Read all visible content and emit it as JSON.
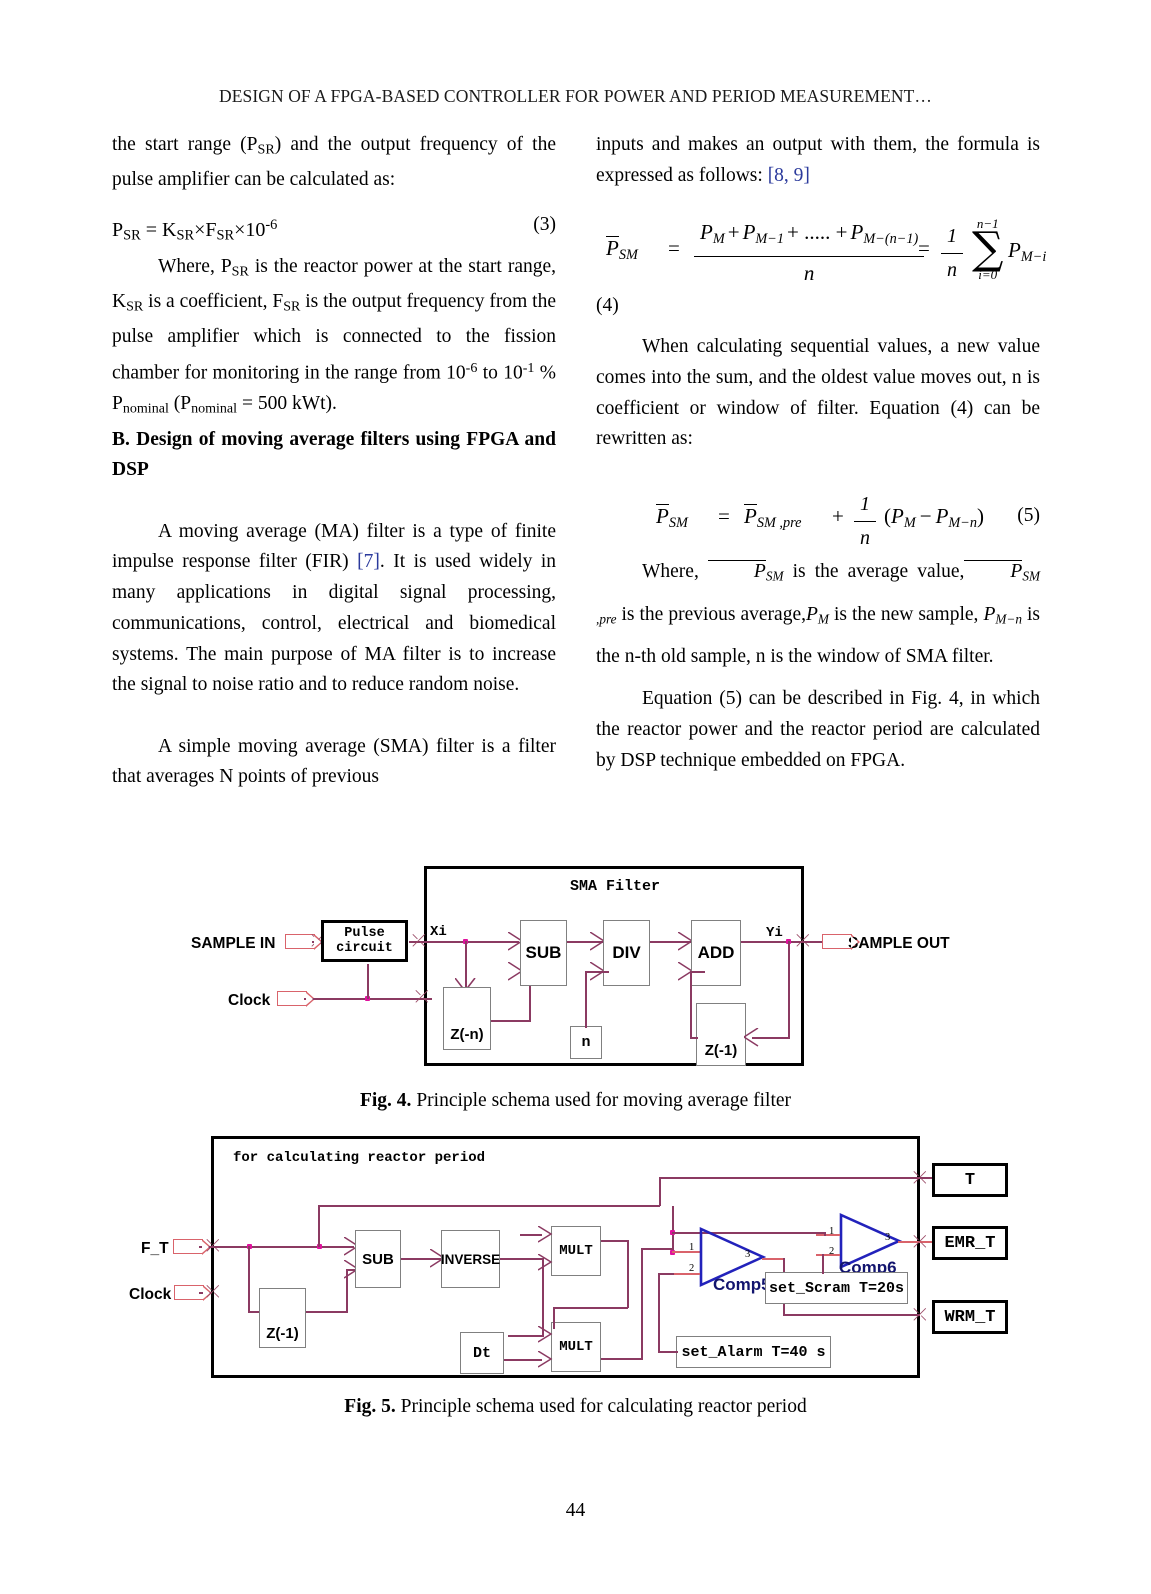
{
  "running_head": "DESIGN OF A FPGA-BASED CONTROLLER FOR POWER AND PERIOD MEASUREMENT…",
  "page_number": "44",
  "left_column": {
    "para1_part1": "the start range (P",
    "para1_sub1": "SR",
    "para1_part2": ") and the output frequency of the pulse amplifier can be calculated as:",
    "eq3": {
      "lhs": "P",
      "lhs_sub": "SR",
      "eq": " = K",
      "k_sub": "SR",
      "times1": "×F",
      "f_sub": "SR",
      "times2": "×10",
      "exp": "-6",
      "number": "(3)"
    },
    "para2": {
      "t1": "Where, P",
      "s1": "SR",
      "t2": " is the reactor power at the start range, K",
      "s2": "SR",
      "t3": " is a coefficient, F",
      "s3": "SR",
      "t4": " is the output frequency from the pulse amplifier which is connected to the fission chamber for monitoring in the range from 10",
      "e1": "-6",
      "t5": " to 10",
      "e2": "-1",
      "t6": " % P",
      "s4": "nominal",
      "t7": " (P",
      "s5": "nominal",
      "t8": " = 500 kWt)."
    },
    "heading_b": "B. Design of moving average filters using FPGA and DSP",
    "para3": {
      "t1": "A moving average (MA) filter is a type of finite impulse response filter (FIR) ",
      "ref": "[7]",
      "t2": ". It is used widely in many applications in digital signal processing, communications, control, electrical and biomedical systems. The main purpose of MA filter is to increase the signal to noise ratio and to reduce random noise."
    },
    "para4": "A simple moving average (SMA) filter is a filter that averages N points of previous"
  },
  "right_column": {
    "para1": {
      "t1": "inputs and makes an output with them, the formula is expressed as follows: ",
      "ref": "[8, 9]"
    },
    "eq4": {
      "lhs_p": "P",
      "lhs_sub": "SM",
      "eq1": "=",
      "num_a": "P",
      "num_a_sub": "M",
      "num_plus1": "+",
      "num_b": "P",
      "num_b_sub": "M−1",
      "num_dots": "+ ..... +",
      "num_c": "P",
      "num_c_sub": "M−(n−1)",
      "den": "n",
      "eq2": "=",
      "frac_num": "1",
      "frac_den": "n",
      "sum_top": "n−1",
      "sum_bottom": "i=0",
      "sum_body": "P",
      "sum_body_sub": "M−i",
      "number": "(4)"
    },
    "para2": "When calculating sequential values, a new value comes into the sum, and the oldest value moves out, n is coefficient or window of filter. Equation (4) can be rewritten as:",
    "eq5": {
      "lhs_p": "P",
      "lhs_sub": "SM",
      "eq1": "=",
      "rhs_p": "P",
      "rhs_sub": "SM ,pre",
      "plus": "+",
      "frac_num": "1",
      "frac_den": "n",
      "paren_open": "(",
      "pm": "P",
      "pm_sub": "M",
      "minus": "−",
      "pmn": "P",
      "pmn_sub": "M−n",
      "paren_close": ")",
      "number": "(5)"
    },
    "para3": {
      "t1": "Where, ",
      "m1": "P",
      "m1_sub": "SM",
      "t2": " is the average value,",
      "m2": "P",
      "m2_sub": "SM ,pre",
      "t3": " is the previous average,",
      "m3": "P",
      "m3_sub": "M",
      "t4": " is the new sample,",
      "m4": "P",
      "m4_sub": "M−n",
      "t5": " is the n-th old sample, n is the window of SMA filter."
    },
    "para4": "Equation (5) can be described in Fig. 4, in which the reactor power and the reactor period are calculated by DSP technique embedded on FPGA."
  },
  "figure4": {
    "caption_label": "Fig. 4.",
    "caption_text": " Principle schema used for moving average filter",
    "title": "SMA Filter",
    "ports_in": [
      "SAMPLE IN",
      "Clock"
    ],
    "ports_out": [
      "SAMPLE OUT"
    ],
    "signal_labels": [
      "Xi",
      "Yi"
    ],
    "blocks": [
      {
        "name": "pulse-circuit",
        "label_line1": "Pulse",
        "label_line2": "circuit"
      },
      {
        "name": "delay-n",
        "label": "Z(-n)"
      },
      {
        "name": "sub",
        "label": "SUB"
      },
      {
        "name": "div",
        "label": "DIV"
      },
      {
        "name": "n-const",
        "label": "n"
      },
      {
        "name": "add",
        "label": "ADD"
      },
      {
        "name": "delay-1",
        "label": "Z(-1)"
      }
    ]
  },
  "figure5": {
    "caption_label": "Fig. 5.",
    "caption_text": " Principle schema used for calculating reactor period",
    "title": "for calculating reactor period",
    "ports_in": [
      "F_T",
      "Clock"
    ],
    "blocks": [
      {
        "name": "delay-1",
        "label": "Z(-1)"
      },
      {
        "name": "sub",
        "label": "SUB"
      },
      {
        "name": "inverse",
        "label": "INVERSE"
      },
      {
        "name": "mult-top",
        "label": "MULT"
      },
      {
        "name": "mult-bottom",
        "label": "MULT"
      },
      {
        "name": "dt-const",
        "label": "Dt"
      }
    ],
    "comparators": [
      {
        "name": "comp5",
        "label": "Comp5",
        "pins": [
          "1",
          "2",
          "3"
        ]
      },
      {
        "name": "comp6",
        "label": "Comp6",
        "pins": [
          "1",
          "2",
          "3"
        ]
      }
    ],
    "setpoints": [
      {
        "name": "set-scram",
        "label": "set_Scram T=20s"
      },
      {
        "name": "set-alarm",
        "label": "set_Alarm T=40 s"
      }
    ],
    "outputs": [
      "T",
      "EMR_T",
      "WRM_T"
    ]
  },
  "colors": {
    "wire": "#8b3a62",
    "wire_red": "#d9636b",
    "junction": "#e0119d",
    "comparator": "#2222bb",
    "comparator_text": "#12146e",
    "reference_link": "#2b3a9c"
  }
}
